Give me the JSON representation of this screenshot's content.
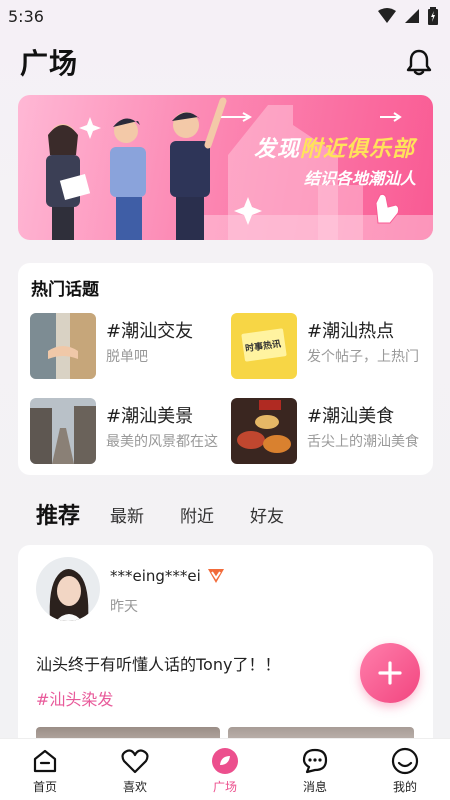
{
  "status_bar": {
    "time": "5:36"
  },
  "header": {
    "title": "广场"
  },
  "banner": {
    "title_part1": "发现",
    "title_part2": "附近俱乐部",
    "subtitle": "结识各地潮汕人"
  },
  "hot_topics": {
    "title": "热门话题",
    "items": [
      {
        "name": "#潮汕交友",
        "desc": "脱单吧"
      },
      {
        "name": "#潮汕热点",
        "desc": "发个帖子，上热门"
      },
      {
        "name": "#潮汕美景",
        "desc": "最美的风景都在这"
      },
      {
        "name": "#潮汕美食",
        "desc": "舌尖上的潮汕美食"
      }
    ],
    "thumb_text": "时事热讯"
  },
  "feed_tabs": [
    "推荐",
    "最新",
    "附近",
    "好友"
  ],
  "post": {
    "username": "***eing***ei",
    "time": "昨天",
    "text": "汕头终于有听懂人话的Tony了！！",
    "tag": "#汕头染发"
  },
  "bottom_nav": [
    {
      "label": "首页",
      "icon": "home-icon"
    },
    {
      "label": "喜欢",
      "icon": "heart-icon"
    },
    {
      "label": "广场",
      "icon": "square-icon"
    },
    {
      "label": "消息",
      "icon": "message-icon"
    },
    {
      "label": "我的",
      "icon": "profile-icon"
    }
  ],
  "colors": {
    "accent": "#ec4f8d",
    "banner_highlight": "#ffe25b"
  }
}
